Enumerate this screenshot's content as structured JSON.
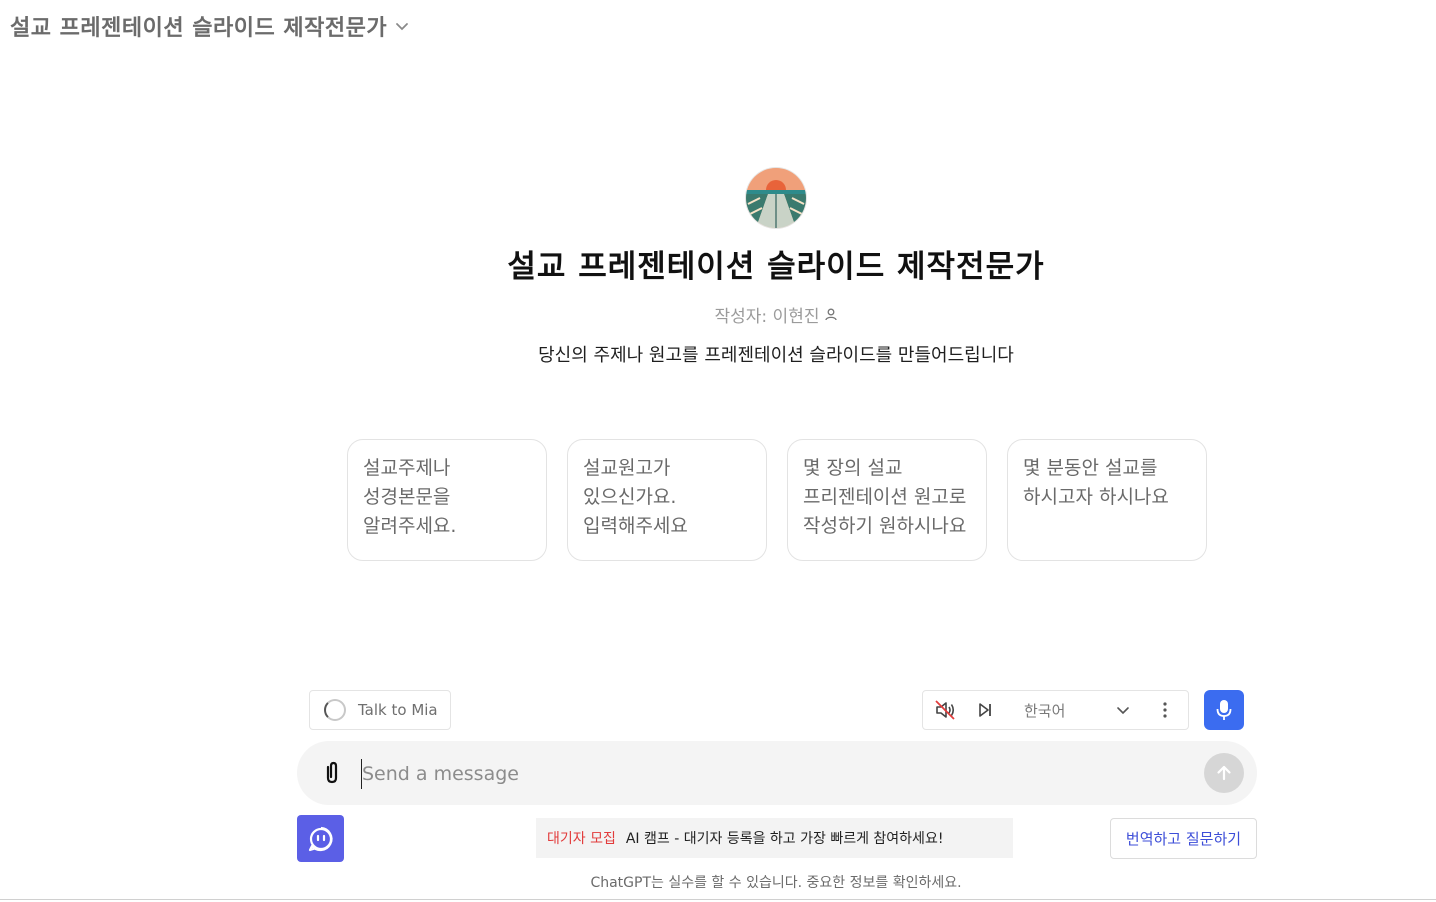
{
  "header": {
    "gpt_name": "설교 프레젠테이션 슬라이드 제작전문가",
    "chevron_icon": "chevron-down-icon"
  },
  "hero": {
    "avatar_icon": "sunset-road-avatar",
    "title": "설교 프레젠테이션 슬라이드 제작전문가",
    "author": "작성자: 이현진",
    "author_icon": "person-icon",
    "description": "당신의 주제나 원고를 프레젠테이션 슬라이드를 만들어드립니다"
  },
  "starters": [
    {
      "text": "설교주제나 성경본문을 알려주세요."
    },
    {
      "text": "설교원고가 있으신가요. 입력해주세요"
    },
    {
      "text": "몇 장의 설교 프리젠테이션 원고로 작성하기 원하시나요"
    },
    {
      "text": "몇 분동안 설교를 하시고자 하시나요"
    }
  ],
  "toolbar": {
    "talk_label": "Talk to Mia",
    "language": "한국어",
    "mute_icon": "speaker-muted-icon",
    "skip_icon": "skip-forward-icon",
    "more_icon": "more-vertical-icon",
    "mic_icon": "microphone-icon"
  },
  "composer": {
    "placeholder": "Send a message",
    "attach_icon": "paperclip-icon",
    "send_icon": "arrow-up-icon"
  },
  "footer": {
    "promo_tag": "대기자 모집",
    "promo_text": "AI 캠프 - 대기자 등록을 하고 가장 빠르게 참여하세요!",
    "translate_label": "번역하고 질문하기",
    "disclaimer": "ChatGPT는 실수를 할 수 있습니다. 중요한 정보를 확인하세요."
  },
  "colors": {
    "accent_blue": "#3b6cf0",
    "bot_purple": "#5b5fe6",
    "promo_red": "#e23b3b",
    "link_blue": "#3d4ed8"
  }
}
